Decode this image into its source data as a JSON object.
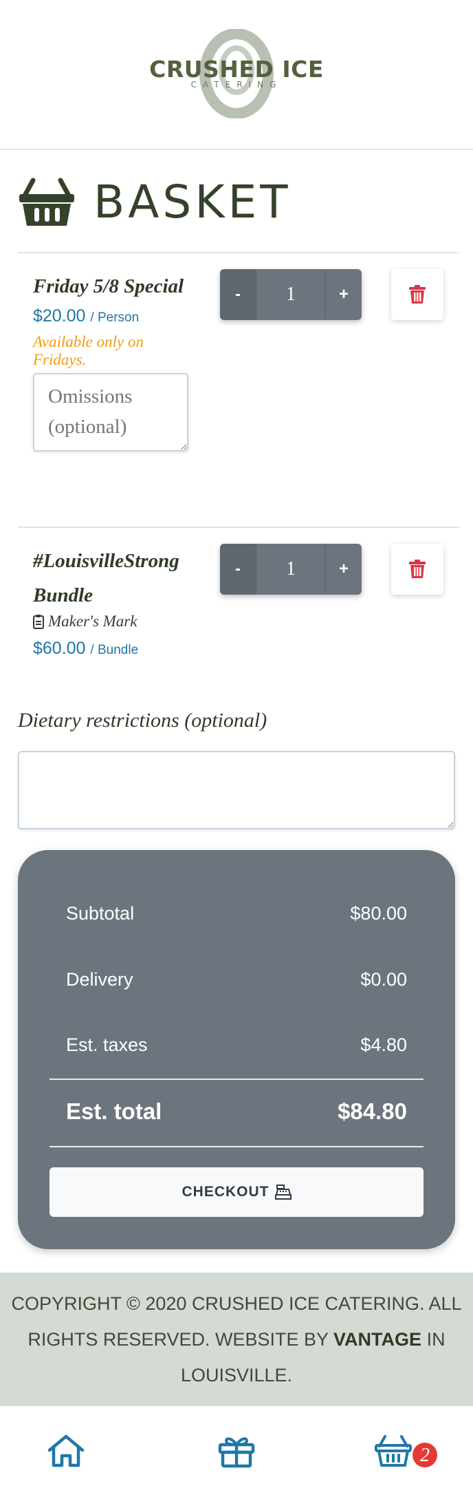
{
  "brand": {
    "name": "CRUSHED ICE",
    "tagline": "CATERING"
  },
  "page": {
    "title": "BASKET"
  },
  "items": [
    {
      "name": "Friday 5/8 Special",
      "price": "$20.00",
      "unit": "/ Person",
      "availability": "Available only on Fridays.",
      "omissions_placeholder": "Omissions (optional)",
      "quantity": "1"
    },
    {
      "name": "#LouisvilleStrong Bundle",
      "note": "Maker's Mark",
      "price": "$60.00",
      "unit": "/ Bundle",
      "quantity": "1"
    }
  ],
  "stepper": {
    "minus": "-",
    "plus": "+"
  },
  "dietary": {
    "label": "Dietary restrictions (optional)",
    "value": ""
  },
  "summary": {
    "subtotal_label": "Subtotal",
    "subtotal": "$80.00",
    "delivery_label": "Delivery",
    "delivery": "$0.00",
    "taxes_label": "Est. taxes",
    "taxes": "$4.80",
    "total_label": "Est. total",
    "total": "$84.80",
    "checkout_label": "CHECKOUT"
  },
  "footer": {
    "copyright": "COPYRIGHT © 2020 CRUSHED ICE CATERING. ALL RIGHTS RESERVED. WEBSITE BY",
    "agency": "VANTAGE",
    "suffix": "IN LOUISVILLE."
  },
  "nav": {
    "basket_count": "2"
  },
  "colors": {
    "accent_blue": "#1f77a8",
    "brand_green": "#55603f",
    "availability_orange": "#f39c12",
    "danger_red": "#dc3545",
    "summary_gray": "#6c757d",
    "footer_bg": "#d3dbd4"
  },
  "icons": [
    "basket-icon",
    "trash-icon",
    "clipboard-icon",
    "cash-register-icon",
    "home-icon",
    "gift-icon",
    "basket-nav-icon"
  ]
}
